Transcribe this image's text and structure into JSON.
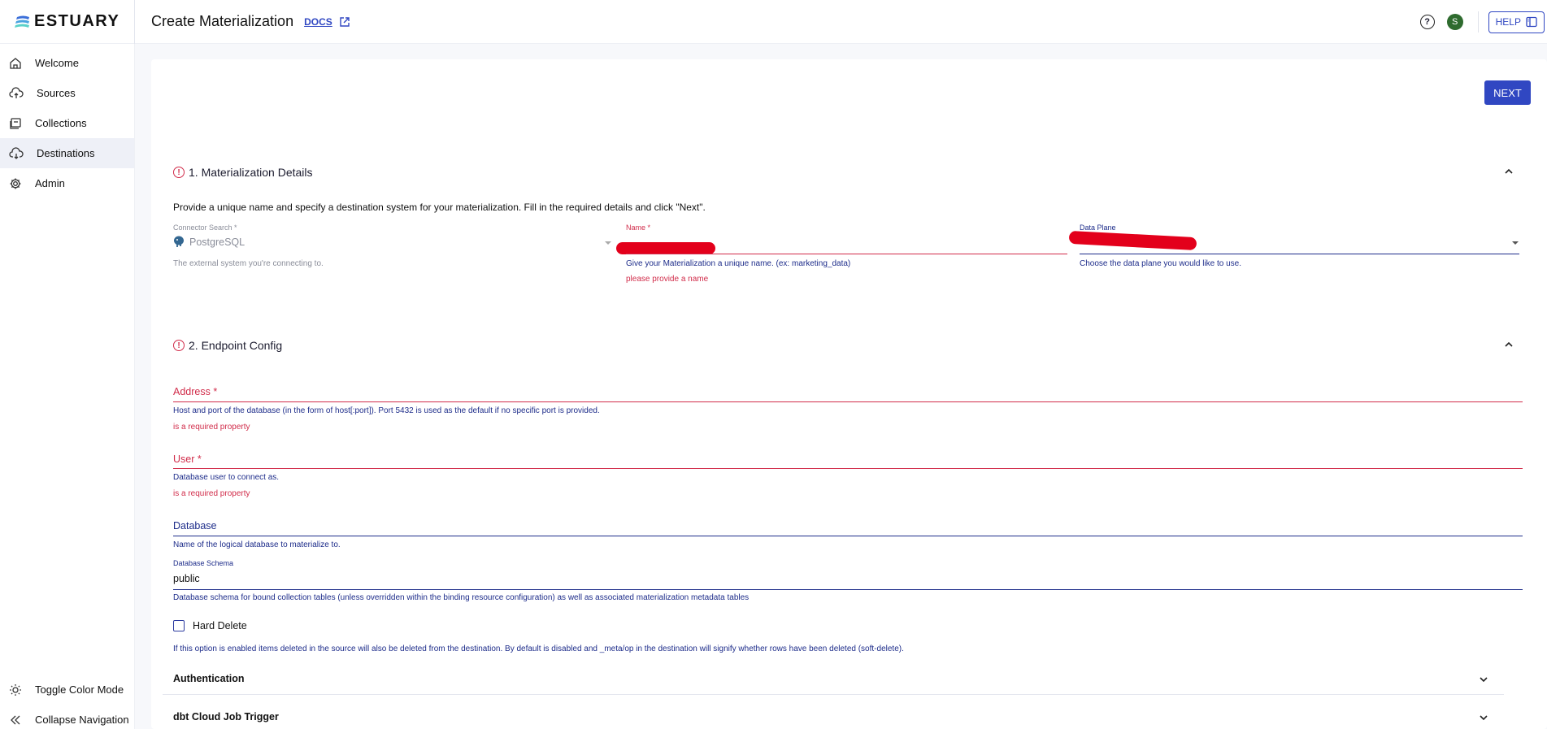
{
  "header": {
    "logo_text": "ESTUARY",
    "page_title": "Create Materialization",
    "docs_label": "DOCS",
    "avatar_initial": "S",
    "help_label": "HELP"
  },
  "sidebar": {
    "items": [
      {
        "label": "Welcome",
        "icon": "home-icon"
      },
      {
        "label": "Sources",
        "icon": "cloud-upload-icon"
      },
      {
        "label": "Collections",
        "icon": "collection-icon"
      },
      {
        "label": "Destinations",
        "icon": "cloud-download-icon",
        "active": true
      },
      {
        "label": "Admin",
        "icon": "gear-icon"
      }
    ],
    "bottom": {
      "toggle_color_mode": "Toggle Color Mode",
      "collapse_navigation": "Collapse Navigation"
    }
  },
  "main": {
    "next_label": "NEXT",
    "section1": {
      "title": "1. Materialization Details",
      "instructions": "Provide a unique name and specify a destination system for your materialization. Fill in the required details and click \"Next\".",
      "connector": {
        "label": "Connector Search *",
        "value": "PostgreSQL",
        "help": "The external system you're connecting to."
      },
      "name": {
        "label": "Name *",
        "help": "Give your Materialization a unique name. (ex: marketing_data)",
        "error": "please provide a name"
      },
      "data_plane": {
        "label": "Data Plane",
        "help": "Choose the data plane you would like to use."
      }
    },
    "section2": {
      "title": "2. Endpoint Config",
      "address": {
        "label": "Address *",
        "help": "Host and port of the database (in the form of host[:port]). Port 5432 is used as the default if no specific port is provided.",
        "error": "is a required property"
      },
      "user": {
        "label": "User *",
        "help": "Database user to connect as.",
        "error": "is a required property"
      },
      "database": {
        "label": "Database",
        "help": "Name of the logical database to materialize to."
      },
      "schema": {
        "label": "Database Schema",
        "value": "public",
        "help": "Database schema for bound collection tables (unless overridden within the binding resource configuration) as well as associated materialization metadata tables"
      },
      "hard_delete": {
        "label": "Hard Delete",
        "checked": false,
        "help": "If this option is enabled items deleted in the source will also be deleted from the destination. By default is disabled and _meta/op in the destination will signify whether rows have been deleted (soft-delete)."
      },
      "accordions": [
        "Authentication",
        "dbt Cloud Job Trigger"
      ]
    }
  },
  "colors": {
    "accent": "#3047c2",
    "error": "#d12c4a",
    "help_text": "#1d2c8a",
    "active_nav_bg": "#eef0f7"
  }
}
